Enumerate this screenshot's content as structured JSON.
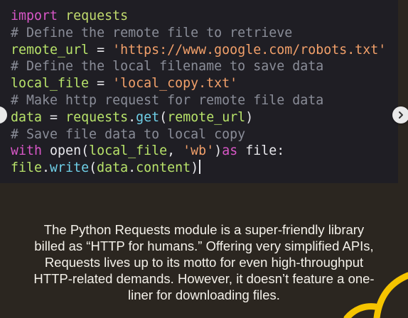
{
  "code": {
    "lines": [
      [
        {
          "t": "import",
          "c": "kw"
        },
        {
          "t": " "
        },
        {
          "t": "requests",
          "c": "mod"
        }
      ],
      [
        {
          "t": "# Define the remote file to retrieve",
          "c": "cm"
        }
      ],
      [
        {
          "t": "remote_url",
          "c": "var"
        },
        {
          "t": " = "
        },
        {
          "t": "'https://www.google.com/robots.txt'",
          "c": "str"
        }
      ],
      [
        {
          "t": "# Define the local filename to save data",
          "c": "cm"
        }
      ],
      [
        {
          "t": "local_file",
          "c": "var"
        },
        {
          "t": " = "
        },
        {
          "t": "'local_copy.txt'",
          "c": "str"
        }
      ],
      [
        {
          "t": "# Make http request for remote file data",
          "c": "cm"
        }
      ],
      [
        {
          "t": "data",
          "c": "var"
        },
        {
          "t": " = "
        },
        {
          "t": "requests",
          "c": "var"
        },
        {
          "t": "."
        },
        {
          "t": "get",
          "c": "fn"
        },
        {
          "t": "("
        },
        {
          "t": "remote_url",
          "c": "var"
        },
        {
          "t": ")"
        }
      ],
      [
        {
          "t": "# Save file data to local copy",
          "c": "cm"
        }
      ],
      [
        {
          "t": "with",
          "c": "kw"
        },
        {
          "t": " "
        },
        {
          "t": "open",
          "c": "plain"
        },
        {
          "t": "("
        },
        {
          "t": "local_file",
          "c": "var"
        },
        {
          "t": ", "
        },
        {
          "t": "'wb'",
          "c": "str"
        },
        {
          "t": ")"
        },
        {
          "t": "as",
          "c": "kw"
        },
        {
          "t": " "
        },
        {
          "t": "file",
          "c": "plain"
        },
        {
          "t": ":"
        }
      ],
      [
        {
          "t": "file",
          "c": "var"
        },
        {
          "t": "."
        },
        {
          "t": "write",
          "c": "fn"
        },
        {
          "t": "("
        },
        {
          "t": "data",
          "c": "var"
        },
        {
          "t": "."
        },
        {
          "t": "content",
          "c": "var"
        },
        {
          "t": ")"
        }
      ]
    ]
  },
  "nav": {
    "left_icon": "chevron-left-icon",
    "right_icon": "chevron-right-icon"
  },
  "caption": {
    "lines": [
      "The Python Requests module is a super-friendly library",
      "billed as “HTTP for humans.” Offering very simplified APIs,",
      "Requests lives up to its motto for even high-throughput",
      "HTTP-related demands. However, it doesn’t feature a one-",
      "liner for downloading files."
    ]
  },
  "colors": {
    "background": "#2b2620",
    "code_panel": "#1f1e24",
    "accent_yellow": "#f5c400"
  }
}
